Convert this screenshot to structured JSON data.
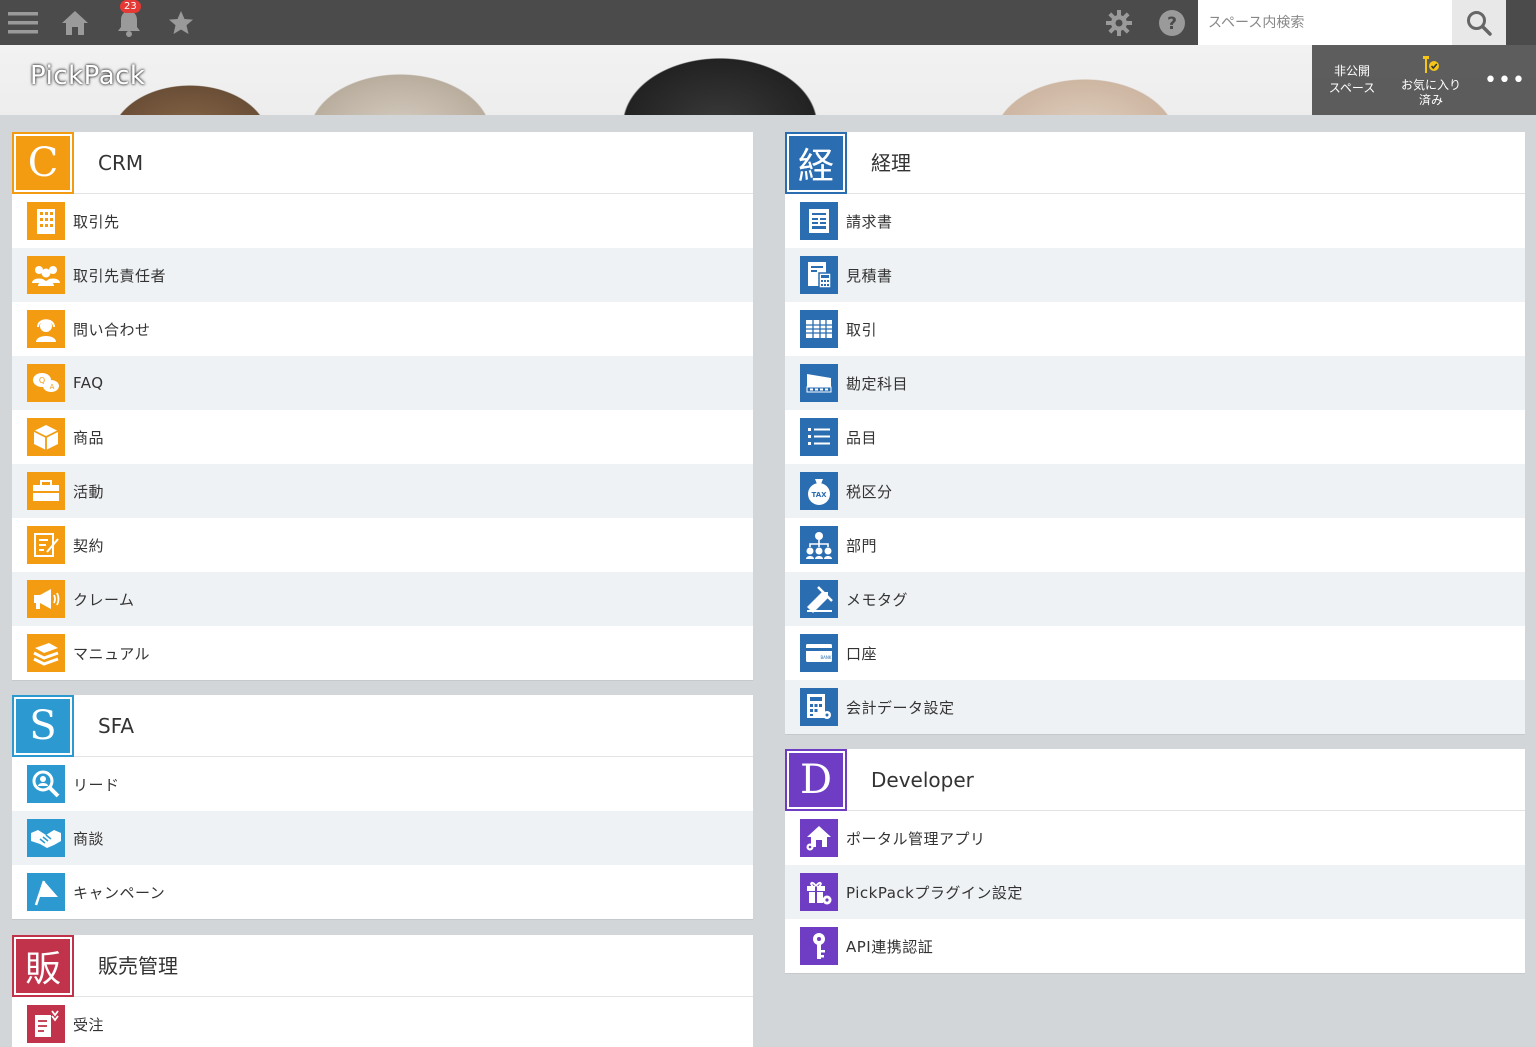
{
  "topbar": {
    "notification_count": "23",
    "search_placeholder": "スペース内検索"
  },
  "header": {
    "space_name": "PickPack",
    "private_label": "非公開\nスペース",
    "favorite_label": "お気に入り\n済み",
    "more_label": "•••"
  },
  "crm": {
    "logo": "C",
    "title": "CRM",
    "color": "#f39c12",
    "items": [
      "取引先",
      "取引先責任者",
      "問い合わせ",
      "FAQ",
      "商品",
      "活動",
      "契約",
      "クレーム",
      "マニュアル"
    ]
  },
  "sfa": {
    "logo": "S",
    "title": "SFA",
    "color": "#2c9ad1",
    "items": [
      "リード",
      "商談",
      "キャンペーン"
    ]
  },
  "sales": {
    "logo": "販",
    "title": "販売管理",
    "color": "#c0334a",
    "items": [
      "受注"
    ]
  },
  "accounting": {
    "logo": "経",
    "title": "経理",
    "color": "#2a6db1",
    "items": [
      "請求書",
      "見積書",
      "取引",
      "勘定科目",
      "品目",
      "税区分",
      "部門",
      "メモタグ",
      "口座",
      "会計データ設定"
    ]
  },
  "developer": {
    "logo": "D",
    "title": "Developer",
    "color": "#6f3cc4",
    "items": [
      "ポータル管理アプリ",
      "PickPackプラグイン設定",
      "API連携認証"
    ]
  }
}
